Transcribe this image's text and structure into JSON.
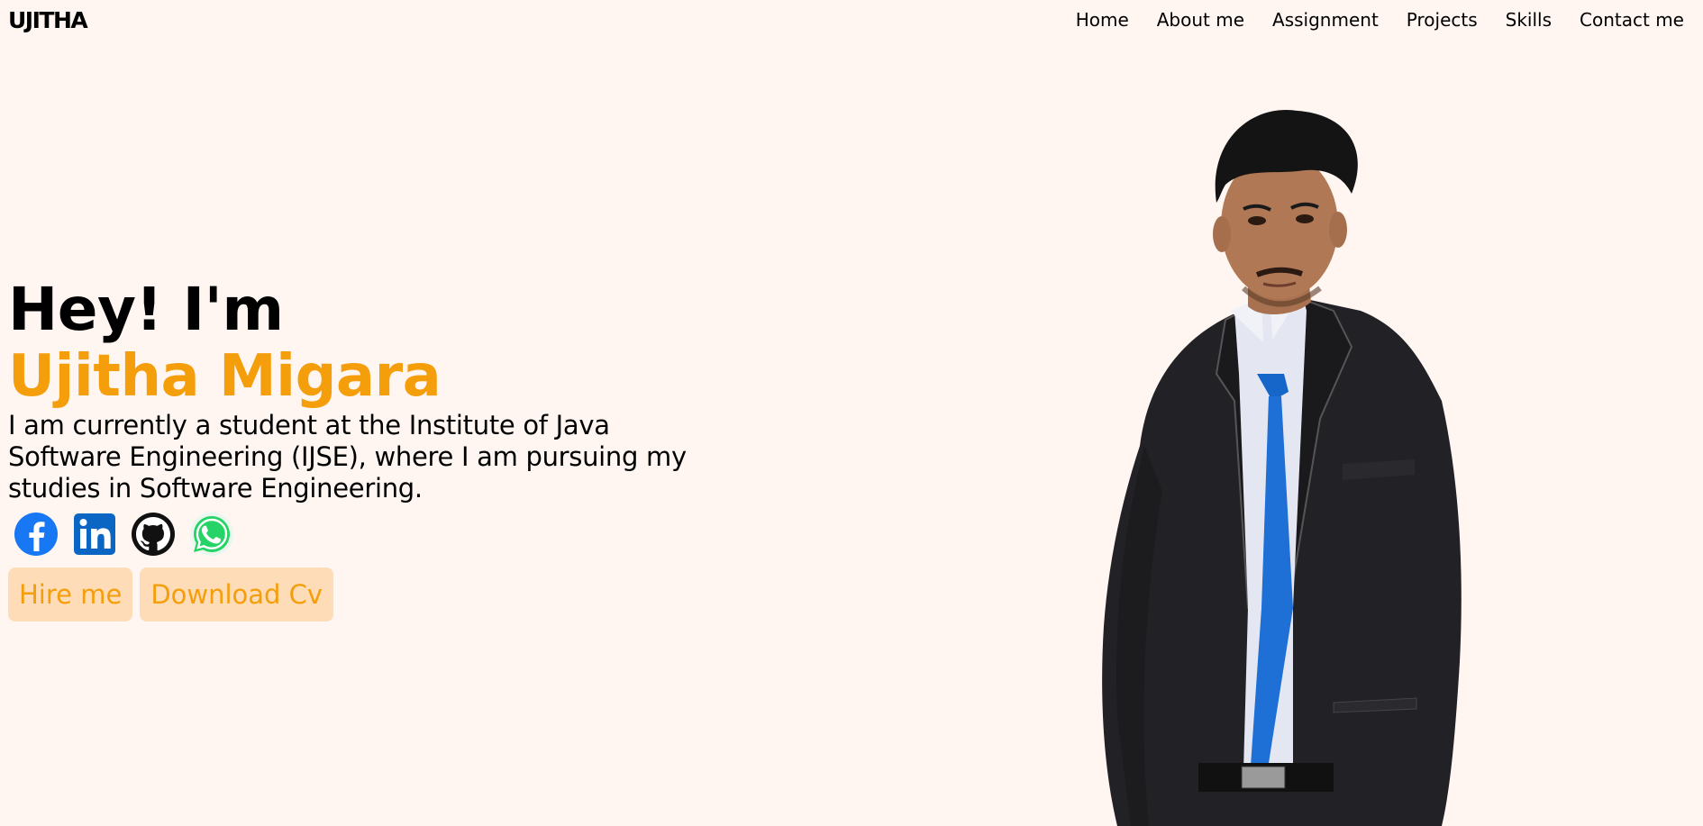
{
  "brand": {
    "logo": "UJITHA"
  },
  "nav": {
    "items": [
      {
        "label": "Home"
      },
      {
        "label": "About me"
      },
      {
        "label": "Assignment"
      },
      {
        "label": "Projects"
      },
      {
        "label": "Skills"
      },
      {
        "label": "Contact me"
      }
    ]
  },
  "hero": {
    "greeting": "Hey! I'm",
    "name": "Ujitha Migara",
    "bio": "I am currently a student at the Institute of Java Software Engineering (IJSE), where I am pursuing my studies in Software Engineering.",
    "accent_color": "#f59e0b",
    "button_bg": "#fddcb7",
    "socials": [
      {
        "icon": "facebook-icon"
      },
      {
        "icon": "linkedin-icon"
      },
      {
        "icon": "github-icon"
      },
      {
        "icon": "whatsapp-icon"
      }
    ],
    "buttons": {
      "hire": "Hire me",
      "download": "Download Cv"
    }
  },
  "colors": {
    "background": "#fff6f1",
    "text": "#000000"
  }
}
